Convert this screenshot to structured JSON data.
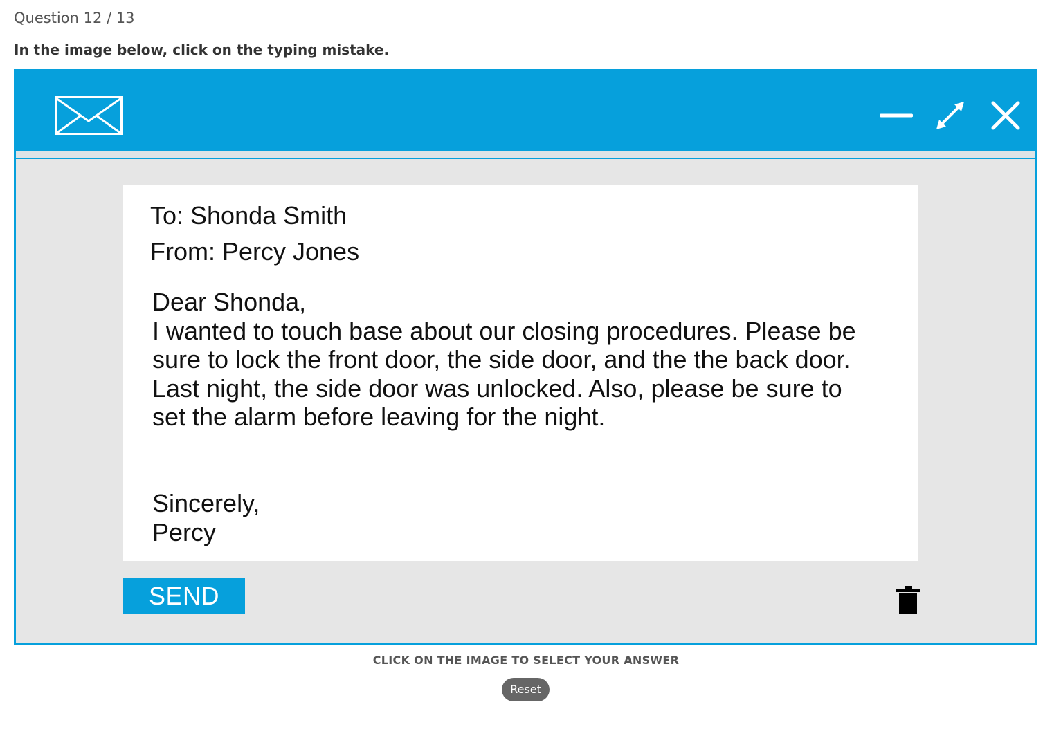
{
  "question": {
    "counter": "Question 12 / 13",
    "prompt": "In the image below, click on the typing mistake."
  },
  "email_window": {
    "icons": {
      "app": "envelope-icon",
      "minimize": "minimize-icon",
      "maximize": "expand-arrows-icon",
      "close": "close-icon",
      "delete": "trash-icon"
    },
    "colors": {
      "accent": "#06a0dc",
      "window_background": "#e6e6e6",
      "card_background": "#ffffff"
    },
    "to": "To: Shonda Smith",
    "from": "From: Percy Jones",
    "greeting": "Dear Shonda,",
    "body_lines": [
      "I wanted to touch base about our closing procedures. Please be",
      "sure to lock the front door, the side door, and the the back door.",
      "Last night, the side door was unlocked. Also, please be sure to",
      "set the alarm before leaving for the night."
    ],
    "closing": "Sincerely,",
    "signature": "Percy",
    "send_label": "SEND"
  },
  "instruction": "CLICK ON THE IMAGE TO SELECT YOUR ANSWER",
  "reset_label": "Reset"
}
